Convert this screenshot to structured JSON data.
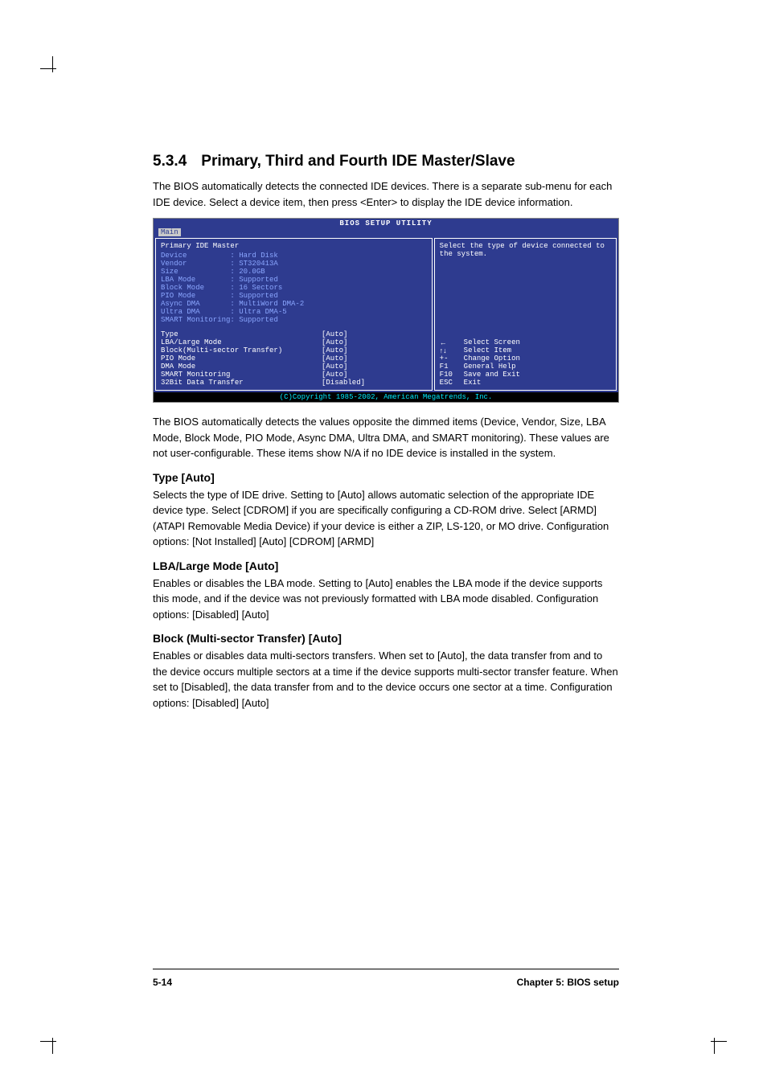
{
  "section": {
    "number": "5.3.4",
    "title": "Primary, Third and Fourth IDE Master/Slave",
    "intro": "The BIOS automatically detects the connected IDE devices. There is a separate sub-menu for each IDE device. Select a device item, then press <Enter> to display the IDE device information."
  },
  "bios": {
    "title": "BIOS SETUP UTILITY",
    "tab": "Main",
    "panel_header": "Primary IDE Master",
    "info": [
      {
        "label": "Device",
        "value": "Hard Disk"
      },
      {
        "label": "Vendor",
        "value": "ST320413A"
      },
      {
        "label": "Size",
        "value": "20.0GB"
      },
      {
        "label": "LBA Mode",
        "value": "Supported"
      },
      {
        "label": "Block Mode",
        "value": "16 Sectors"
      },
      {
        "label": "PIO Mode",
        "value": "Supported"
      },
      {
        "label": "Async DMA",
        "value": "MultiWord DMA-2"
      },
      {
        "label": "Ultra DMA",
        "value": "Ultra DMA-5"
      },
      {
        "label": "SMART Monitoring",
        "value": "Supported"
      }
    ],
    "settings": [
      {
        "label": "Type",
        "value": "[Auto]"
      },
      {
        "label": "LBA/Large Mode",
        "value": "[Auto]"
      },
      {
        "label": "Block(Multi-sector Transfer)",
        "value": "[Auto]"
      },
      {
        "label": "PIO Mode",
        "value": "[Auto]"
      },
      {
        "label": "DMA Mode",
        "value": "[Auto]"
      },
      {
        "label": "SMART Monitoring",
        "value": "[Auto]"
      },
      {
        "label": "32Bit Data Transfer",
        "value": "[Disabled]"
      }
    ],
    "help_top": "Select the type of device connected to the system.",
    "help_keys": [
      {
        "key": "←",
        "desc": "Select Screen"
      },
      {
        "key": "↑↓",
        "desc": "Select Item"
      },
      {
        "key": "+-",
        "desc": "Change Option"
      },
      {
        "key": "F1",
        "desc": "General Help"
      },
      {
        "key": "F10",
        "desc": "Save and Exit"
      },
      {
        "key": "ESC",
        "desc": "Exit"
      }
    ],
    "footer": "(C)Copyright 1985-2002, American Megatrends, Inc."
  },
  "after_bios": "The BIOS automatically detects the values opposite the dimmed items (Device, Vendor, Size, LBA Mode, Block Mode, PIO Mode, Async DMA, Ultra DMA, and SMART monitoring). These values are not user-configurable. These items show N/A if no IDE device is installed in the system.",
  "subsections": [
    {
      "heading": "Type [Auto]",
      "text": "Selects the type of IDE drive. Setting to [Auto] allows automatic selection of the appropriate IDE device type. Select [CDROM] if you are specifically configuring a CD-ROM drive. Select [ARMD] (ATAPI Removable Media Device) if your device is either a ZIP, LS-120, or MO drive. Configuration options: [Not Installed] [Auto] [CDROM] [ARMD]"
    },
    {
      "heading": "LBA/Large Mode [Auto]",
      "text": "Enables or disables the LBA mode. Setting to [Auto] enables the LBA mode if the device supports this mode, and if the device was not previously formatted with LBA mode disabled. Configuration options: [Disabled] [Auto]"
    },
    {
      "heading": "Block (Multi-sector Transfer) [Auto]",
      "text": "Enables or disables data multi-sectors transfers. When set to [Auto], the data transfer from and to the device occurs multiple sectors at a time if the device supports multi-sector transfer feature. When set to [Disabled], the data transfer from and to the device occurs one sector at a time. Configuration options: [Disabled] [Auto]"
    }
  ],
  "footer": {
    "page": "5-14",
    "chapter": "Chapter 5: BIOS setup"
  }
}
